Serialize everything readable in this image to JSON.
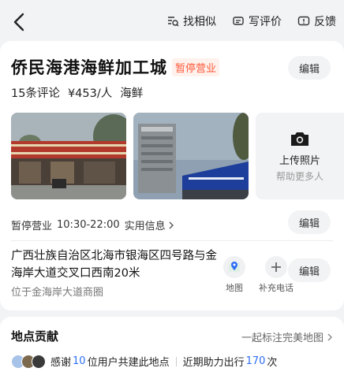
{
  "topbar": {
    "actions": [
      {
        "label": "找相似",
        "icon": "find-similar-icon"
      },
      {
        "label": "写评价",
        "icon": "write-review-icon"
      },
      {
        "label": "反馈",
        "icon": "feedback-icon"
      }
    ]
  },
  "poi": {
    "name": "侨民海港海鲜加工城",
    "status_tag": "暂停营业",
    "review_count": "15条评论",
    "price": "¥453/人",
    "category": "海鲜",
    "edit_label": "编辑"
  },
  "photos": {
    "upload_label": "上传照片",
    "upload_sub": "帮助更多人"
  },
  "hours": {
    "status": "暂停营业",
    "time": "10:30-22:00",
    "info_link": "实用信息",
    "edit_label": "编辑"
  },
  "address": {
    "text": "广西壮族自治区北海市银海区四号路与金海岸大道交叉口西南20米",
    "sub": "位于金海岸大道商圈",
    "map_label": "地图",
    "phone_label": "补充电话",
    "edit_label": "编辑"
  },
  "contribution": {
    "title": "地点贡献",
    "link": "一起标注完美地图",
    "thanks_prefix": "感谢",
    "user_count": "10",
    "thanks_suffix": "位用户共建此地点",
    "recent_prefix": "近期助力出行",
    "trip_count": "170",
    "recent_suffix": "次"
  },
  "colors": {
    "accent_orange": "#ff5a3c",
    "link_blue": "#2f6ff5",
    "background": "#f2f3f5"
  }
}
